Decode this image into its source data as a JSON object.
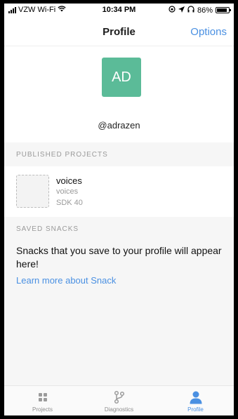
{
  "status": {
    "carrier": "VZW Wi-Fi",
    "time": "10:34 PM",
    "battery_text": "86%",
    "battery_level": 0.86
  },
  "nav": {
    "title": "Profile",
    "options_label": "Options"
  },
  "profile": {
    "initials": "AD",
    "username": "@adrazen",
    "avatar_color": "#5bbb98"
  },
  "published": {
    "label": "PUBLISHED PROJECTS",
    "project": {
      "name": "voices",
      "slug": "voices",
      "sdk": "SDK 40"
    }
  },
  "saved": {
    "label": "SAVED SNACKS",
    "message": "Snacks that you save to your profile will appear here!",
    "link": "Learn more about Snack"
  },
  "tabs": [
    {
      "label": "Projects",
      "icon": "grid-icon",
      "active": false
    },
    {
      "label": "Diagnostics",
      "icon": "branch-icon",
      "active": false
    },
    {
      "label": "Profile",
      "icon": "person-icon",
      "active": true
    }
  ],
  "colors": {
    "accent": "#4a90e2"
  }
}
